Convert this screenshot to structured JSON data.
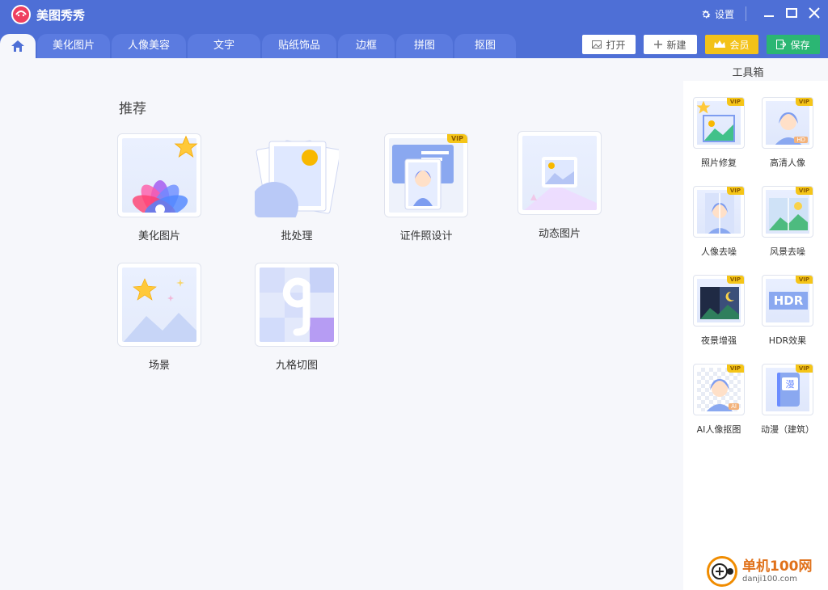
{
  "app": {
    "title": "美图秀秀",
    "settings_label": "设置"
  },
  "tabs": [
    {
      "label": "美化图片"
    },
    {
      "label": "人像美容"
    },
    {
      "label": "文字"
    },
    {
      "label": "贴纸饰品"
    },
    {
      "label": "边框"
    },
    {
      "label": "拼图"
    },
    {
      "label": "抠图"
    }
  ],
  "toolbar": {
    "open": "打开",
    "new": "新建",
    "vip": "会员",
    "save": "保存"
  },
  "recommend": {
    "title": "推荐",
    "items": [
      {
        "label": "美化图片"
      },
      {
        "label": "批处理"
      },
      {
        "label": "证件照设计",
        "badge": "VIP"
      },
      {
        "label": "动态图片"
      },
      {
        "label": "场景"
      },
      {
        "label": "九格切图"
      }
    ]
  },
  "toolbox": {
    "title": "工具箱",
    "items": [
      {
        "label": "照片修复",
        "badge": "VIP"
      },
      {
        "label": "高清人像",
        "badge": "VIP",
        "sub_badge": "HD"
      },
      {
        "label": "人像去噪",
        "badge": "VIP"
      },
      {
        "label": "风景去噪",
        "badge": "VIP"
      },
      {
        "label": "夜景增强",
        "badge": "VIP"
      },
      {
        "label": "HDR效果",
        "badge": "VIP",
        "icon_text": "HDR"
      },
      {
        "label": "AI人像抠图",
        "badge": "VIP",
        "sub_badge": "AI"
      },
      {
        "label": "动漫（建筑）",
        "badge": "VIP",
        "icon_text": "漫"
      }
    ]
  },
  "watermark": {
    "name": "单机100网",
    "url": "danji100.com"
  },
  "colors": {
    "titlebar": "#4e6fd6",
    "vip": "#f5c518",
    "save": "#2bb673",
    "accent": "#4e6fd6"
  }
}
